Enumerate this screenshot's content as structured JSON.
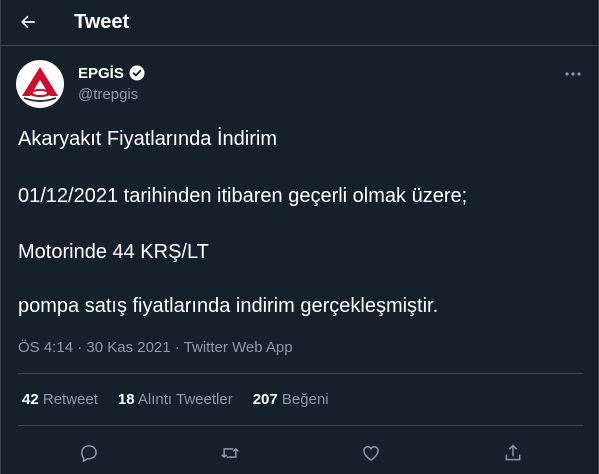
{
  "header": {
    "title": "Tweet"
  },
  "author": {
    "name": "EPGİS",
    "handle": "@trepgis",
    "verified": true
  },
  "tweet": {
    "lines": [
      "Akaryakıt Fiyatlarında İndirim",
      "01/12/2021 tarihinden itibaren geçerli olmak üzere;",
      "Motorinde 44 KRŞ/LT",
      "pompa satış fiyatlarında indirim gerçekleşmiştir."
    ]
  },
  "meta": {
    "text": "ÖS 4:14 · 30 Kas 2021 · Twitter Web App"
  },
  "stats": {
    "retweets": {
      "count": "42",
      "label": "Retweet"
    },
    "quotes": {
      "count": "18",
      "label": "Alıntı Tweetler"
    },
    "likes": {
      "count": "207",
      "label": "Beğeni"
    }
  },
  "icons": {
    "back": "arrow-left-icon",
    "verified": "verified-badge-icon",
    "more": "more-icon",
    "reply": "reply-icon",
    "retweet": "retweet-icon",
    "like": "heart-icon",
    "share": "share-icon"
  },
  "colors": {
    "background": "#15202b",
    "border": "#38444d",
    "secondary_text": "#8b98a5",
    "logo_red": "#c8102e"
  }
}
